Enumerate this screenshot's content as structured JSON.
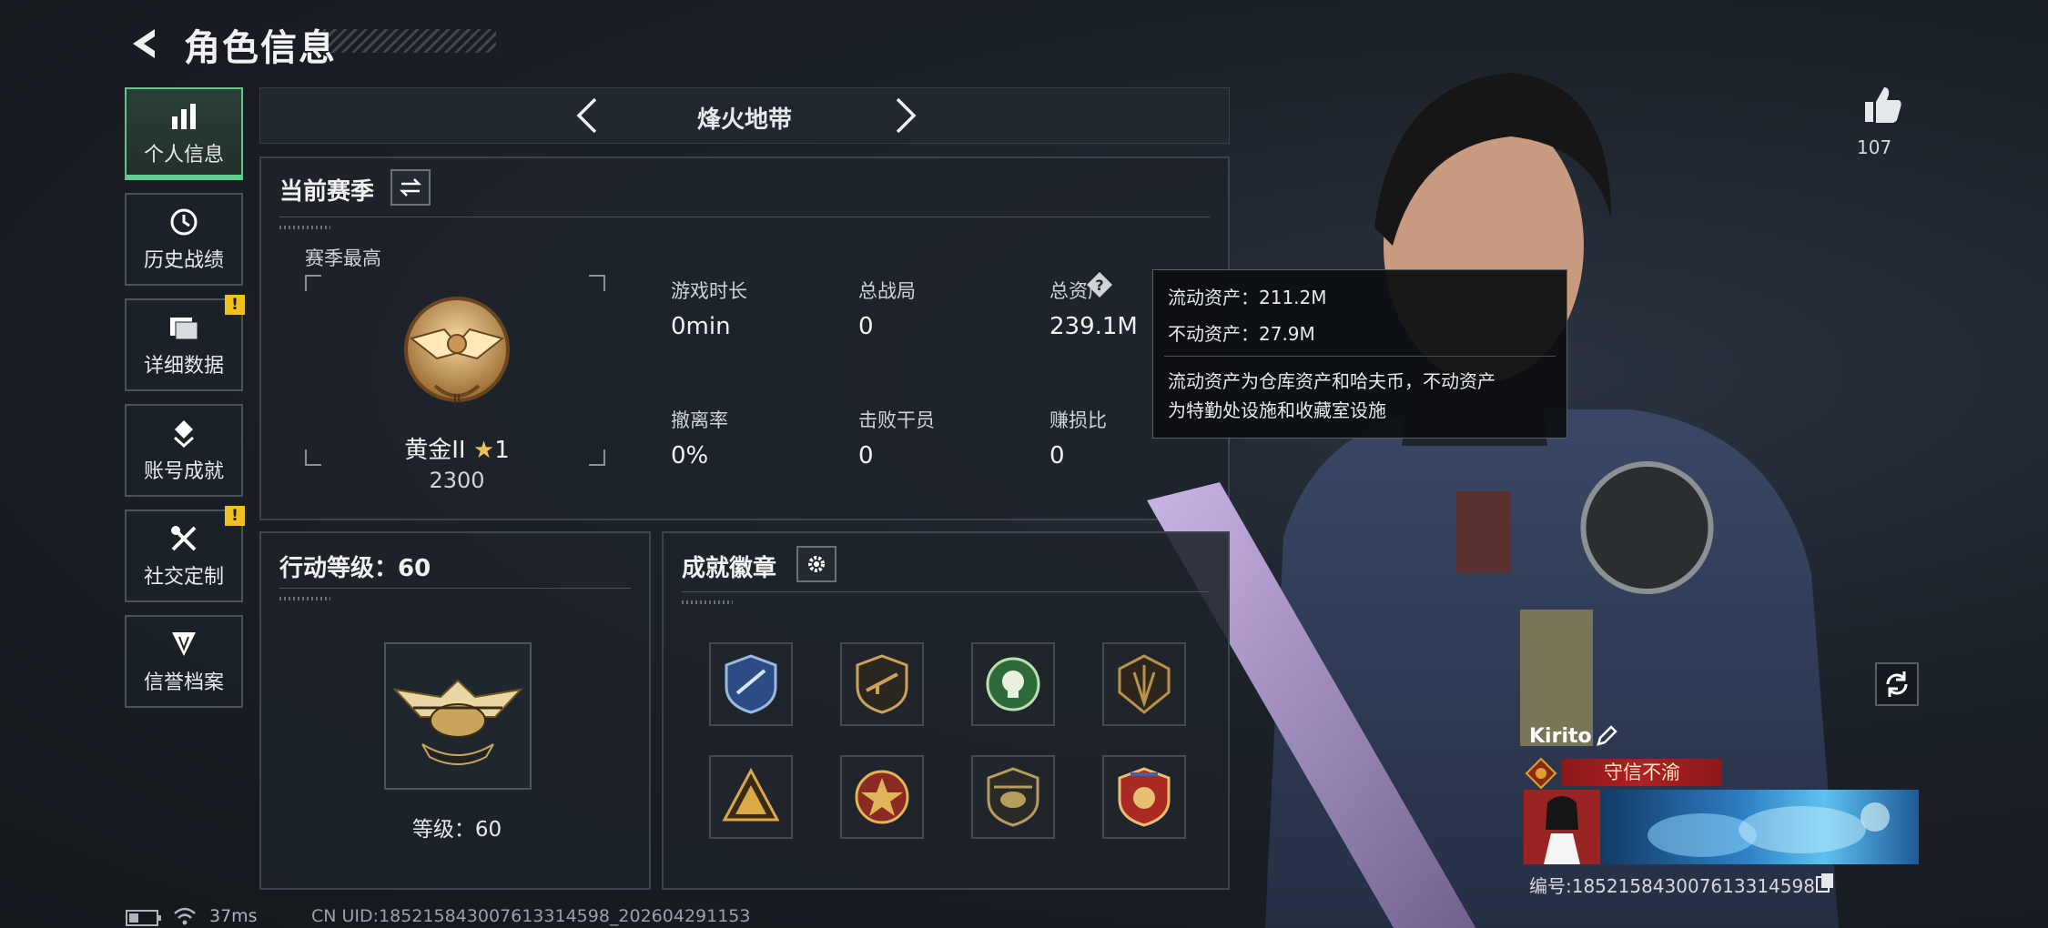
{
  "header": {
    "title": "角色信息"
  },
  "nav": {
    "items": [
      {
        "label": "个人信息",
        "icon": "bar-chart-icon",
        "active": true,
        "alert": false
      },
      {
        "label": "历史战绩",
        "icon": "history-icon",
        "active": false,
        "alert": false
      },
      {
        "label": "详细数据",
        "icon": "folder-icon",
        "active": false,
        "alert": true
      },
      {
        "label": "账号成就",
        "icon": "achievement-icon",
        "active": false,
        "alert": false
      },
      {
        "label": "社交定制",
        "icon": "tools-icon",
        "active": false,
        "alert": true
      },
      {
        "label": "信誉档案",
        "icon": "reputation-icon",
        "active": false,
        "alert": false
      }
    ],
    "alert_mark": "!"
  },
  "mode": {
    "title": "烽火地带"
  },
  "season": {
    "heading": "当前赛季",
    "best_label": "赛季最高",
    "rank_name": "黄金II",
    "rank_stars": "1",
    "rank_score": "2300",
    "stats": [
      {
        "label": "游戏时长",
        "value": "0min"
      },
      {
        "label": "总战局",
        "value": "0"
      },
      {
        "label": "总资产",
        "value": "239.1M"
      },
      {
        "label": "撤离率",
        "value": "0%"
      },
      {
        "label": "击败干员",
        "value": "0"
      },
      {
        "label": "赚损比",
        "value": "0"
      }
    ]
  },
  "tooltip": {
    "liquid": "流动资产：211.2M",
    "fixed": "不动资产：27.9M",
    "note_line1": "流动资产为仓库资产和哈夫币，不动资产",
    "note_line2": "为特勤处设施和收藏室设施"
  },
  "level": {
    "heading": "行动等级：60",
    "level_text": "等级：60"
  },
  "badges": {
    "heading": "成就徽章",
    "items": [
      "blue-shield-badge",
      "gold-rifle-badge",
      "green-skull-badge",
      "gold-blade-badge",
      "gold-pyramid-badge",
      "red-star-badge",
      "gold-helicopter-badge",
      "red-shield-badge"
    ]
  },
  "likes": {
    "count": "107"
  },
  "player": {
    "name": "Kirito",
    "title": "守信不渝",
    "id_text": "编号:18521584300761331459​8"
  },
  "footer": {
    "ping": "37ms",
    "uid": "CN UID:185215843007613314598_202604291153"
  },
  "colors": {
    "accent_green": "#5fd08d",
    "alert_yellow": "#f0c020",
    "banner_red": "#b02020"
  }
}
